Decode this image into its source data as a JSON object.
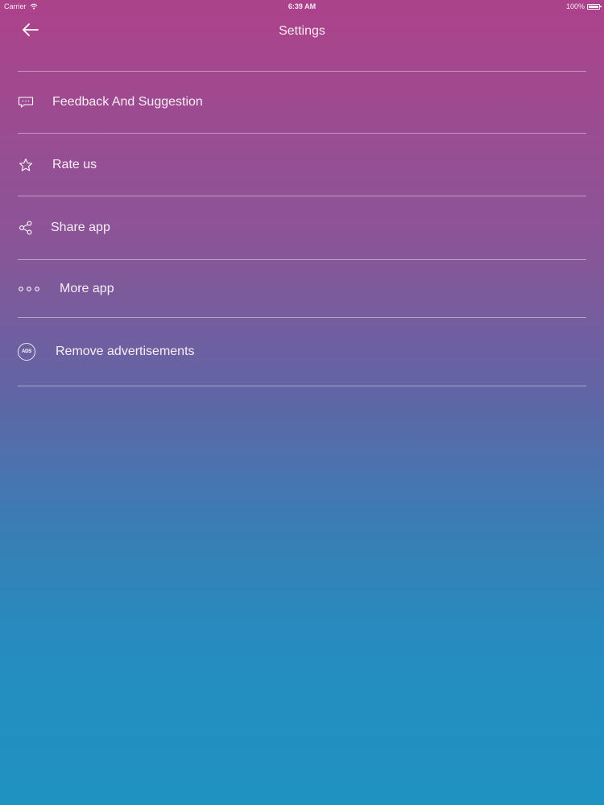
{
  "status_bar": {
    "carrier": "Carrier",
    "time": "6:39 AM",
    "battery": "100%"
  },
  "header": {
    "title": "Settings",
    "back_icon": "arrow-left-icon"
  },
  "menu": {
    "items": [
      {
        "label": "Feedback And Suggestion",
        "icon": "chat-bubble-icon"
      },
      {
        "label": "Rate us",
        "icon": "star-icon"
      },
      {
        "label": "Share app",
        "icon": "share-icon"
      },
      {
        "label": "More app",
        "icon": "more-dots-icon"
      },
      {
        "label": "Remove advertisements",
        "icon": "ads-icon",
        "icon_text": "ADS"
      }
    ]
  },
  "colors": {
    "gradient_top": "#ad428b",
    "gradient_bottom": "#1e93c1",
    "text": "#ffffff"
  }
}
